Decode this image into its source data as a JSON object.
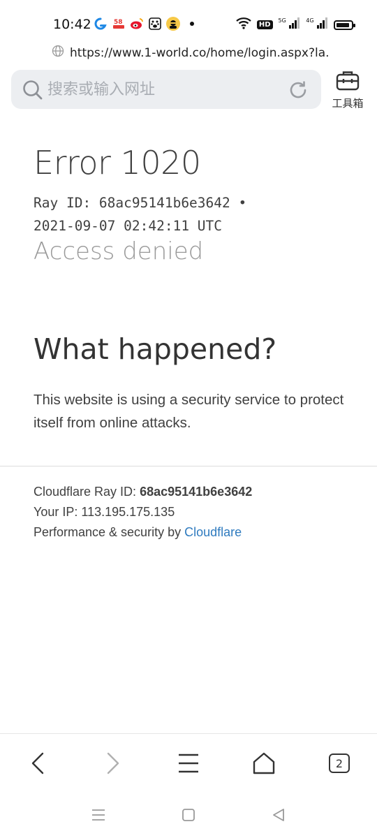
{
  "status_bar": {
    "time": "10:42",
    "notification_icons": [
      "browser-app-icon",
      "58-app-icon",
      "weibo-app-icon",
      "baidu-app-icon",
      "avatar-app-icon"
    ],
    "network_badge": "HD",
    "signal_1_label": "5G",
    "signal_2_label": "4G"
  },
  "browser": {
    "url": "https://www.1-world.co/home/login.aspx?la...",
    "search_placeholder": "搜索或输入网址",
    "toolbox_label": "工具箱",
    "tabs_count": "2"
  },
  "page": {
    "error_title": "Error 1020",
    "ray_line1": "Ray ID: 68ac95141b6e3642 •",
    "ray_line2": "2021-09-07 02:42:11 UTC",
    "access_denied": "Access denied",
    "what_happened_heading": "What happened?",
    "description": "This website is using a security service to protect itself from online attacks.",
    "footer": {
      "ray_label": "Cloudflare Ray ID:",
      "ray_value": "68ac95141b6e3642",
      "ip_label": "Your IP:",
      "ip_value": "113.195.175.135",
      "perf_label": "Performance & security by",
      "perf_link": "Cloudflare"
    }
  },
  "colors": {
    "link": "#2f7bbf",
    "muted_text": "#999999",
    "body_text": "#404040",
    "search_bg": "#eceef1"
  }
}
